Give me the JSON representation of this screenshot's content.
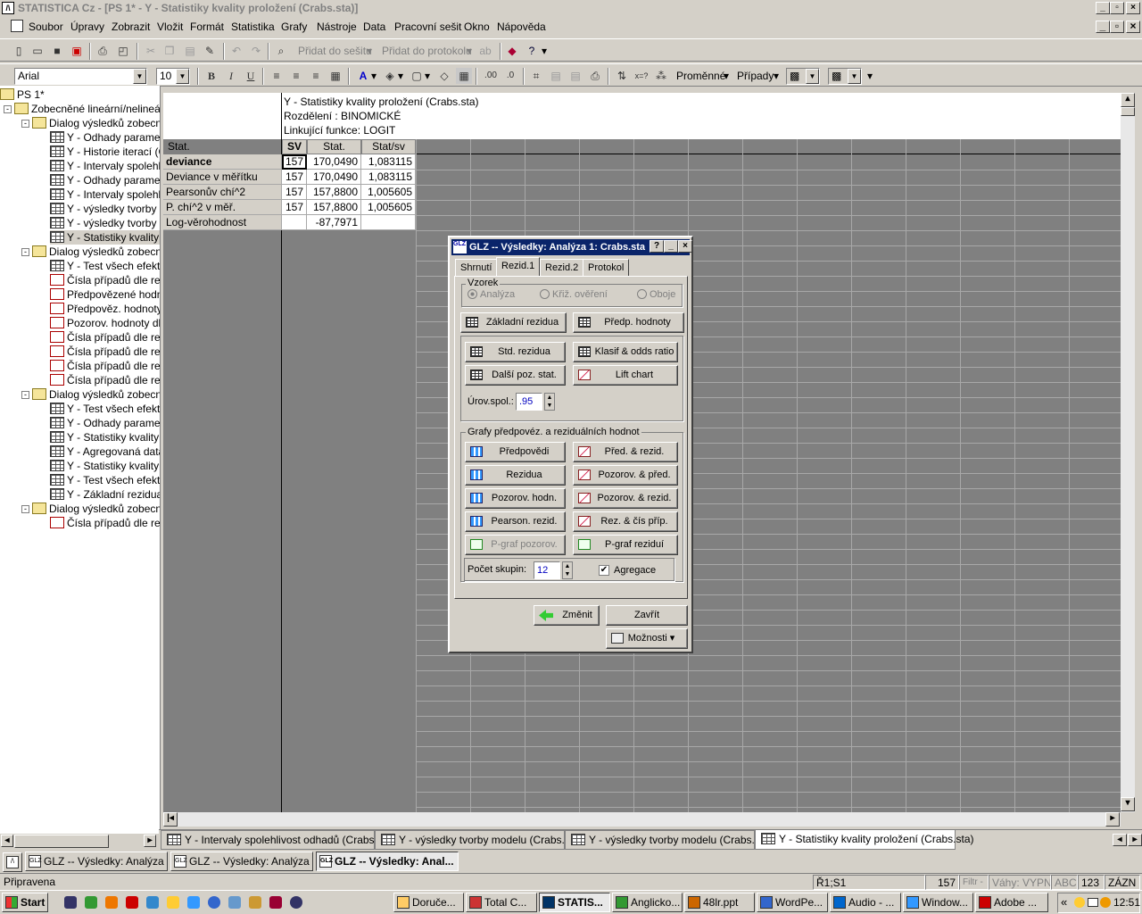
{
  "app": {
    "title": "STATISTICA Cz - [PS 1* - Y - Statistiky kvality proložení (Crabs.sta)]",
    "logo": "StSt"
  },
  "menu": [
    "Soubor",
    "Úpravy",
    "Zobrazit",
    "Vložit",
    "Formát",
    "Statistika",
    "Grafy",
    "Nástroje",
    "Data",
    "Pracovní sešit",
    "Okno",
    "Nápověda"
  ],
  "toolbar1": {
    "add_to_workbook": "Přidat do sešitu",
    "add_to_report": "Přidat do protokolu"
  },
  "toolbar2": {
    "font": "Arial",
    "size": "10",
    "bold": "B",
    "italic": "I",
    "underline": "U",
    "variables": "Proměnné",
    "cases": "Případy"
  },
  "tree": {
    "root": "PS 1*",
    "group": "Zobecněné lineární/nelineární",
    "items": [
      {
        "t": "dialog",
        "label": "Dialog výsledků zobecněných"
      },
      {
        "t": "sheet",
        "label": "Y - Odhady parametrů"
      },
      {
        "t": "sheet",
        "label": "Y - Historie iterací (Crabs"
      },
      {
        "t": "sheet",
        "label": "Y - Intervaly spolehlivost"
      },
      {
        "t": "sheet",
        "label": "Y - Odhady parametrů"
      },
      {
        "t": "sheet",
        "label": "Y - Intervaly spolehlivost"
      },
      {
        "t": "sheet",
        "label": "Y - výsledky tvorby modelu"
      },
      {
        "t": "sheet",
        "label": "Y - výsledky tvorby modelu"
      },
      {
        "t": "sheet",
        "label": "Y - Statistiky kvality proložení"
      },
      {
        "t": "dialog",
        "label": "Dialog výsledků zobecněných"
      },
      {
        "t": "sheet",
        "label": "Y - Test všech efektů"
      },
      {
        "t": "graph",
        "label": "Čísla případů dle rezidua"
      },
      {
        "t": "graph",
        "label": "Předpovězené hodnoty"
      },
      {
        "t": "graph",
        "label": "Předpověz. hodnoty"
      },
      {
        "t": "graph",
        "label": "Pozorov. hodnoty dle"
      },
      {
        "t": "graph",
        "label": "Čísla případů dle rezidua"
      },
      {
        "t": "graph",
        "label": "Čísla případů dle rezidua"
      },
      {
        "t": "graph",
        "label": "Čísla případů dle rezidua"
      },
      {
        "t": "graph",
        "label": "Čísla případů dle rezidua"
      },
      {
        "t": "dialog",
        "label": "Dialog výsledků zobecněných"
      },
      {
        "t": "sheet",
        "label": "Y - Test všech efektů"
      },
      {
        "t": "sheet",
        "label": "Y - Odhady parametrů"
      },
      {
        "t": "sheet",
        "label": "Y - Statistiky kvality proložení"
      },
      {
        "t": "sheet",
        "label": "Y - Agregovaná data"
      },
      {
        "t": "sheet",
        "label": "Y - Statistiky kvality proložení"
      },
      {
        "t": "sheet",
        "label": "Y - Test všech efektů"
      },
      {
        "t": "sheet",
        "label": "Y - Základní rezidua ("
      },
      {
        "t": "dialog",
        "label": "Dialog výsledků zobecněných"
      },
      {
        "t": "graph",
        "label": "Čísla případů dle rezidua"
      }
    ]
  },
  "sheet": {
    "header_lines": [
      "Y - Statistiky kvality proložení (Crabs.sta)",
      "Rozdělení : BINOMICKÉ",
      "Linkující funkce: LOGIT"
    ],
    "corner": "Stat.",
    "columns": [
      "SV",
      "Stat.",
      "Stat/sv"
    ],
    "rows": [
      {
        "name": "deviance",
        "sv": "157",
        "stat": "170,0490",
        "ratio": "1,083115"
      },
      {
        "name": "Deviance v měřítku",
        "sv": "157",
        "stat": "170,0490",
        "ratio": "1,083115"
      },
      {
        "name": "Pearsonův chí^2",
        "sv": "157",
        "stat": "157,8800",
        "ratio": "1,005605"
      },
      {
        "name": "P. chí^2 v měř.",
        "sv": "157",
        "stat": "157,8800",
        "ratio": "1,005605"
      },
      {
        "name": "Log-věrohodnost",
        "sv": "",
        "stat": "-87,7971",
        "ratio": ""
      }
    ]
  },
  "dialog": {
    "title": "GLZ -- Výsledky: Analýza 1: Crabs.sta",
    "tabs": [
      "Shrnutí",
      "Rezid.1",
      "Rezid.2",
      "Protokol"
    ],
    "sample_label": "Vzorek",
    "sample_options": [
      "Analýza",
      "Křiž. ověření",
      "Oboje"
    ],
    "btn_basic": "Základní rezidua",
    "btn_pred": "Předp. hodnoty",
    "btn_std": "Std. rezidua",
    "btn_klasif": "Klasif & odds ratio",
    "btn_other": "Další poz. stat.",
    "btn_lift": "Lift chart",
    "conf_label": "Úrov.spol.:",
    "conf_value": ".95",
    "graphs_label": "Grafy předpovéz. a reziduálních hodnot",
    "g_btns": [
      "Předpovědi",
      "Před. & rezid.",
      "Rezidua",
      "Pozorov. & před.",
      "Pozorov. hodn.",
      "Pozorov. & rezid.",
      "Pearson. rezid.",
      "Rez. & čís příp.",
      "P-graf pozorov.",
      "P-graf reziduí"
    ],
    "groups_label": "Počet skupin:",
    "groups_value": "12",
    "aggregate_label": "Agregace",
    "btn_change": "Změnit",
    "btn_close": "Zavřít",
    "btn_options": "Možnosti"
  },
  "sheet_tabs": [
    "Y - Intervaly spolehlivost odhadů (Crabs.sta)",
    "Y - výsledky tvorby modelu (Crabs.sta)",
    "Y - výsledky tvorby modelu (Crabs.sta)",
    "Y - Statistiky kvality proložení (Crabs.sta)"
  ],
  "mdi_tasks": [
    "GLZ -- Výsledky: Analýza 1...",
    "GLZ -- Výsledky: Analýza 1...",
    "GLZ -- Výsledky: Anal..."
  ],
  "status": {
    "ready": "Připravena",
    "cell": "Ř1;S1",
    "count": "157",
    "filter": "Filtr -",
    "weights": "Váhy: VYPN",
    "abc": "ABC",
    "num": "123",
    "mode": "ZÁZN"
  },
  "taskbar": {
    "start": "Start",
    "items": [
      "Doruče...",
      "Total C...",
      "STATIS...",
      "Anglicko...",
      "48lr.ppt",
      "WordPe...",
      "Audio - ...",
      "Window...",
      "Adobe ..."
    ],
    "clock": "12:51",
    "chevron": "«"
  }
}
